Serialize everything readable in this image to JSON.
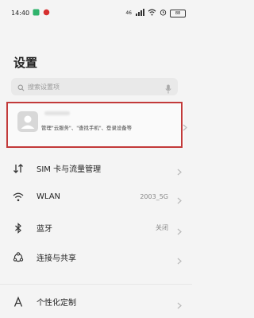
{
  "status_bar": {
    "time": "14:40",
    "network": "46",
    "battery": "88"
  },
  "page": {
    "title": "设置"
  },
  "search": {
    "placeholder": "搜索设置项"
  },
  "account": {
    "subtitle": "管理\"云服务\"、\"查找手机\"、登录设备等"
  },
  "settings": [
    {
      "label": "SIM 卡与流量管理",
      "value": "",
      "icon": "sim-traffic-icon"
    },
    {
      "label": "WLAN",
      "value": "2003_5G",
      "icon": "wifi-icon"
    },
    {
      "label": "蓝牙",
      "value": "关闭",
      "icon": "bluetooth-icon"
    },
    {
      "label": "连接与共享",
      "value": "",
      "icon": "connection-share-icon"
    },
    {
      "label": "个性化定制",
      "value": "",
      "icon": "personalization-icon"
    }
  ]
}
